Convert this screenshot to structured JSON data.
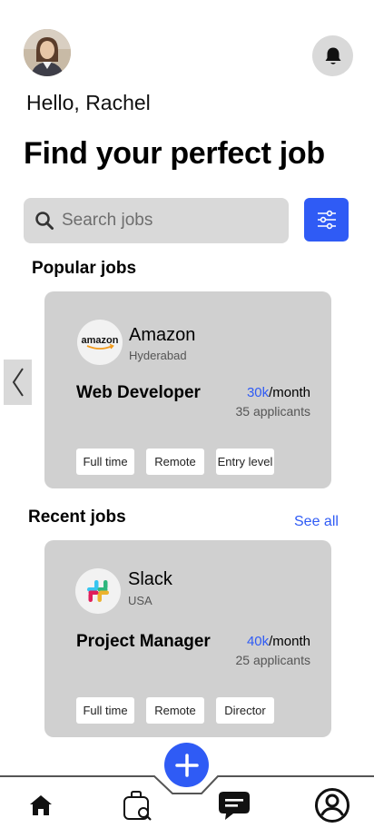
{
  "header": {
    "greeting": "Hello, Rachel",
    "headline": "Find your perfect job"
  },
  "search": {
    "placeholder": "Search jobs"
  },
  "popular": {
    "title": "Popular jobs",
    "job": {
      "company": "Amazon",
      "logo_text": "amazon",
      "location": "Hyderabad",
      "role": "Web Developer",
      "salary_amount": "30k",
      "salary_period": "/month",
      "applicants": "35 applicants",
      "tags": [
        "Full time",
        "Remote",
        "Entry level"
      ]
    }
  },
  "recent": {
    "title": "Recent jobs",
    "see_all": "See all",
    "job": {
      "company": "Slack",
      "location": "USA",
      "role": "Project Manager",
      "salary_amount": "40k",
      "salary_period": "/month",
      "applicants": "25 applicants",
      "tags": [
        "Full time",
        "Remote",
        "Director"
      ]
    }
  },
  "nav": {
    "items": [
      "home-icon",
      "job-search-icon",
      "chat-icon",
      "profile-icon"
    ],
    "fab": "plus-icon"
  },
  "colors": {
    "accent": "#2f5bf5",
    "card": "#d0d0d0",
    "chip": "#d9d9d9"
  }
}
